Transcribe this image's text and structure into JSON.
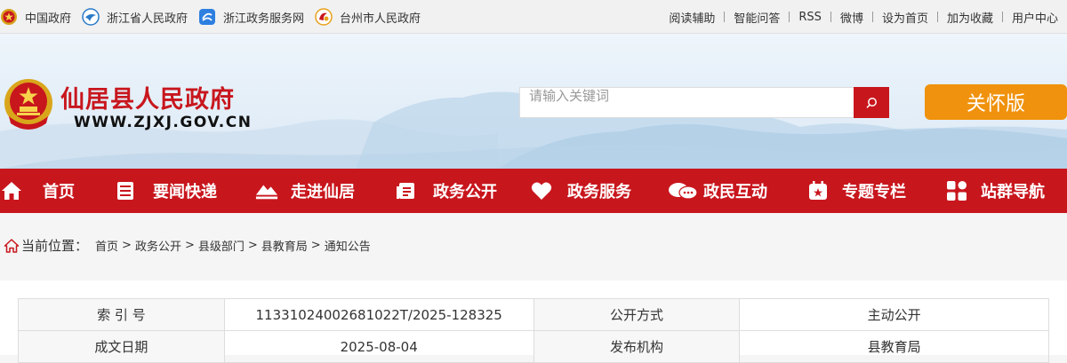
{
  "topbar": {
    "left_links": [
      {
        "label": "中国政府",
        "icon": "national-emblem-icon"
      },
      {
        "label": "浙江省人民政府",
        "icon": "zhejiang-logo-icon"
      },
      {
        "label": "浙江政务服务网",
        "icon": "service-net-icon"
      },
      {
        "label": "台州市人民政府",
        "icon": "taizhou-logo-icon"
      }
    ],
    "right_links": [
      "阅读辅助",
      "智能问答",
      "RSS",
      "微博",
      "设为首页",
      "加为收藏",
      "用户中心"
    ]
  },
  "header": {
    "title": "仙居县人民政府",
    "url": "WWW.ZJXJ.GOV.CN",
    "search_placeholder": "请输入关键词",
    "care_button": "关怀版",
    "accent_color": "#c8161d",
    "care_color": "#f0920d"
  },
  "nav": {
    "items": [
      {
        "label": "首页",
        "icon": "home-icon"
      },
      {
        "label": "要闻快递",
        "icon": "news-icon"
      },
      {
        "label": "走进仙居",
        "icon": "mountain-icon"
      },
      {
        "label": "政务公开",
        "icon": "document-icon"
      },
      {
        "label": "政务服务",
        "icon": "heart-icon"
      },
      {
        "label": "政民互动",
        "icon": "chat-icon"
      },
      {
        "label": "专题专栏",
        "icon": "bookmark-icon"
      },
      {
        "label": "站群导航",
        "icon": "grid-icon"
      }
    ]
  },
  "breadcrumb": {
    "current_label": "当前位置：",
    "items": [
      "首页",
      "政务公开",
      "县级部门",
      "县教育局",
      "通知公告"
    ],
    "separator": ">"
  },
  "info_table": {
    "rows": [
      [
        "索 引 号",
        "11331024002681022T/2025-128325",
        "公开方式",
        "主动公开"
      ],
      [
        "成文日期",
        "2025-08-04",
        "发布机构",
        "县教育局"
      ]
    ]
  }
}
